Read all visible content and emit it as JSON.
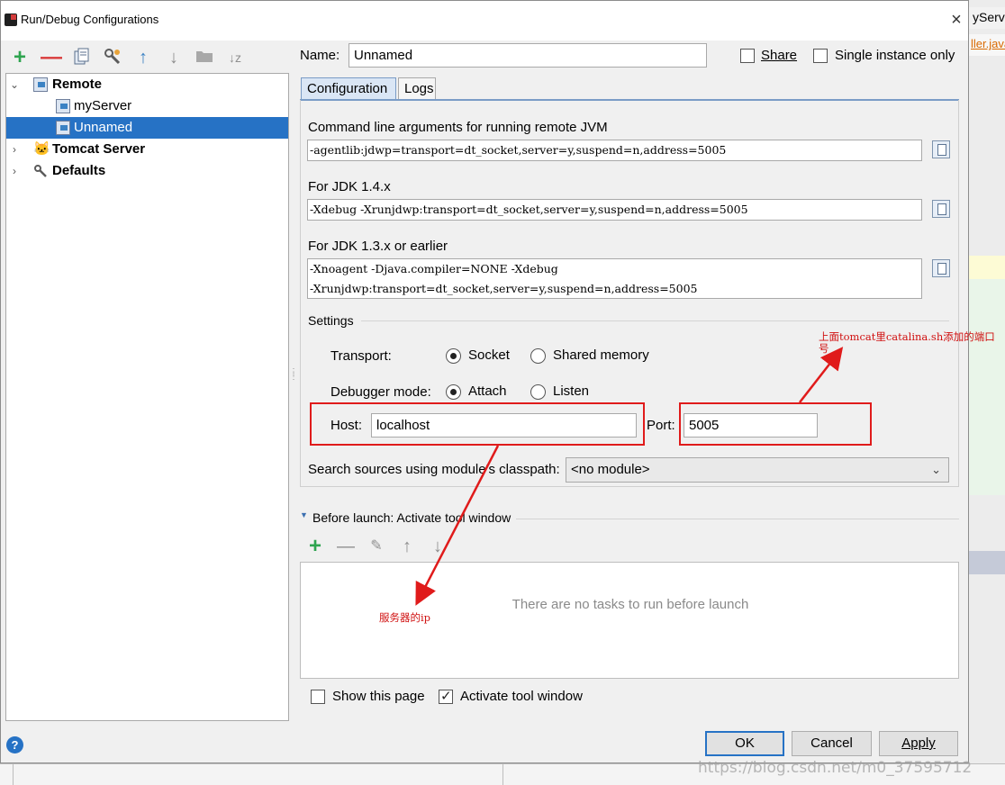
{
  "background": {
    "tab_partial": "yServer",
    "file_partial": "ller.java"
  },
  "dialog": {
    "title": "Run/Debug Configurations",
    "close": "×"
  },
  "toolbar": {
    "add": "+",
    "remove": "—",
    "copy_icon": "copy-icon",
    "wrench_icon": "wrench-icon",
    "up": "↑",
    "down": "↓",
    "folder_icon": "folder-icon",
    "sort": "↓z"
  },
  "tree": {
    "items": [
      {
        "label": "Remote",
        "level": 0,
        "expanded": true
      },
      {
        "label": "myServer",
        "level": 1
      },
      {
        "label": "Unnamed",
        "level": 1,
        "selected": true
      },
      {
        "label": "Tomcat Server",
        "level": 0,
        "expanded": false
      },
      {
        "label": "Defaults",
        "level": 0,
        "expanded": false
      }
    ]
  },
  "form": {
    "name_label": "Name:",
    "name_value": "Unnamed",
    "share_label": "Share",
    "share_checked": false,
    "single_instance_label": "Single instance only",
    "single_instance_checked": false,
    "tabs": [
      "Configuration",
      "Logs"
    ],
    "active_tab": "Configuration",
    "cmd_label": "Command line arguments for running remote JVM",
    "cmd_value": "-agentlib:jdwp=transport=dt_socket,server=y,suspend=n,address=5005",
    "jdk14_label": "For JDK 1.4.x",
    "jdk14_value": "-Xdebug -Xrunjdwp:transport=dt_socket,server=y,suspend=n,address=5005",
    "jdk13_label": "For JDK 1.3.x or earlier",
    "jdk13_line1": "-Xnoagent -Djava.compiler=NONE -Xdebug",
    "jdk13_line2": "-Xrunjdwp:transport=dt_socket,server=y,suspend=n,address=5005",
    "settings_label": "Settings",
    "transport_label": "Transport:",
    "transport_socket": "Socket",
    "transport_shared": "Shared memory",
    "transport_selected": "Socket",
    "debugger_label": "Debugger mode:",
    "debugger_attach": "Attach",
    "debugger_listen": "Listen",
    "debugger_selected": "Attach",
    "host_label": "Host:",
    "host_value": "localhost",
    "port_label": "Port:",
    "port_value": "5005",
    "module_label": "Search sources using module's classpath:",
    "module_value": "<no module>"
  },
  "before_launch": {
    "title": "Before launch: Activate tool window",
    "empty_text": "There are no tasks to run before launch",
    "show_page_label": "Show this page",
    "show_page_checked": false,
    "activate_label": "Activate tool window",
    "activate_checked": true
  },
  "buttons": {
    "ok": "OK",
    "cancel": "Cancel",
    "apply": "Apply",
    "help": "?"
  },
  "annotations": {
    "port_note": "上面tomcat里catalina.sh添加的端口号",
    "host_note": "服务器的ip",
    "color": "#e01b1b"
  },
  "watermark": "https://blog.csdn.net/m0_37595712"
}
